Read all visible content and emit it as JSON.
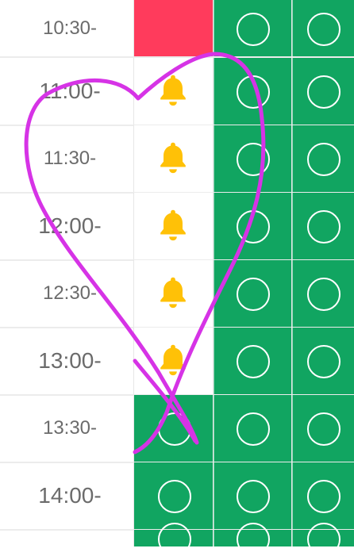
{
  "rows": [
    {
      "time": "10:30-",
      "cells": [
        "red",
        "available",
        "available"
      ]
    },
    {
      "time": "11:00-",
      "cells": [
        "bell",
        "available",
        "available"
      ]
    },
    {
      "time": "11:30-",
      "cells": [
        "bell",
        "available",
        "available"
      ]
    },
    {
      "time": "12:00-",
      "cells": [
        "bell",
        "available",
        "available"
      ]
    },
    {
      "time": "12:30-",
      "cells": [
        "bell",
        "available",
        "available"
      ]
    },
    {
      "time": "13:00-",
      "cells": [
        "bell",
        "available",
        "available"
      ]
    },
    {
      "time": "13:30-",
      "cells": [
        "available",
        "available",
        "available"
      ]
    },
    {
      "time": "14:00-",
      "cells": [
        "available",
        "available",
        "available"
      ]
    },
    {
      "time": "",
      "cells": [
        "available",
        "available",
        "available"
      ]
    }
  ],
  "icons": {
    "available": "circle-icon",
    "bell": "bell-icon"
  },
  "colors": {
    "available": "#11a561",
    "booked": "#ff3b5c",
    "bell": "#ffc107",
    "time_text": "#6b6b6b",
    "heart_stroke": "#d633e6"
  }
}
